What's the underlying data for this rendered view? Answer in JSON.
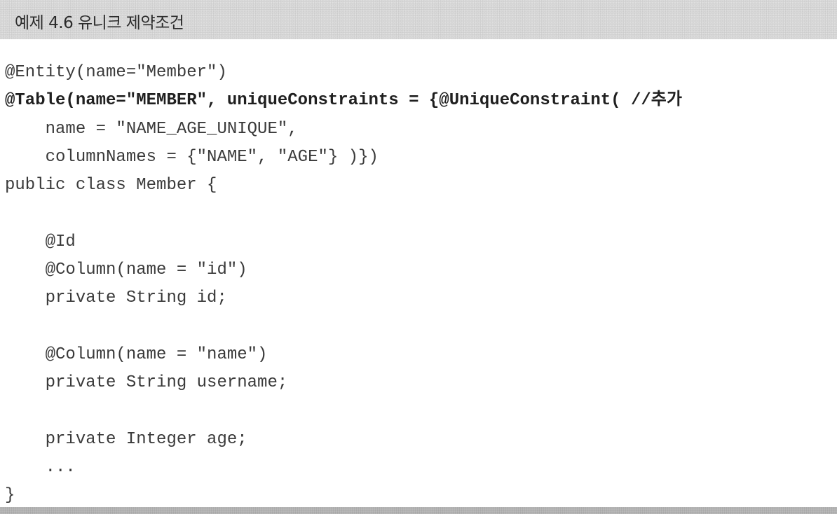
{
  "header": {
    "title": "예제 4.6 유니크 제약조건"
  },
  "code": {
    "lines": [
      "@Entity(name=\"Member\")",
      "@Table(name=\"MEMBER\", uniqueConstraints = {@UniqueConstraint( //추가",
      "    name = \"NAME_AGE_UNIQUE\",",
      "    columnNames = {\"NAME\", \"AGE\"} )})",
      "public class Member {",
      "",
      "    @Id",
      "    @Column(name = \"id\")",
      "    private String id;",
      "",
      "    @Column(name = \"name\")",
      "    private String username;",
      "",
      "    private Integer age;",
      "    ...",
      "}"
    ]
  }
}
